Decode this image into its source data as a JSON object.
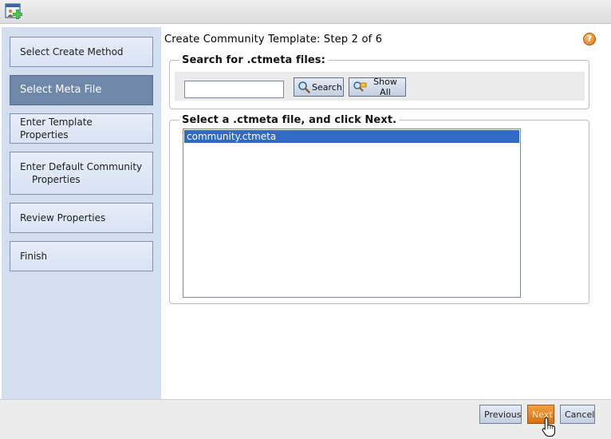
{
  "window": {
    "icon": "add-community-icon"
  },
  "steps": [
    {
      "label": "Select Create Method",
      "active": false
    },
    {
      "label": "Select Meta File",
      "active": true
    },
    {
      "label": "Enter Template Properties",
      "active": false
    },
    {
      "line1": "Enter Default Community",
      "line2": "Properties",
      "active": false
    },
    {
      "label": "Review Properties",
      "active": false
    },
    {
      "label": "Finish",
      "active": false
    }
  ],
  "main": {
    "title": "Create Community Template: Step 2 of 6",
    "help_icon": "help-icon",
    "search": {
      "legend": "Search for .ctmeta files:",
      "input_value": "",
      "search_label": "Search",
      "show_all_label": "Show All"
    },
    "files": {
      "legend": "Select a .ctmeta file, and click Next.",
      "items": [
        {
          "name": "community.ctmeta",
          "selected": true
        }
      ]
    }
  },
  "footer": {
    "previous_label": "Previous",
    "next_label": "Next",
    "cancel_label": "Cancel"
  },
  "colors": {
    "sidebar_bg": "#d3deef",
    "active_step": "#6f87a9",
    "selection": "#316ac5",
    "primary_button": "#e8861f"
  }
}
